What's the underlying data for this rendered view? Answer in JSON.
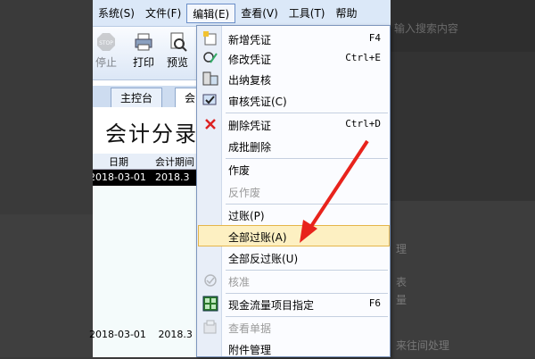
{
  "menubar": {
    "items": [
      {
        "label": "系统(S)"
      },
      {
        "label": "文件(F)"
      },
      {
        "label": "编辑(E)"
      },
      {
        "label": "查看(V)"
      },
      {
        "label": "工具(T)"
      },
      {
        "label": "帮助"
      }
    ]
  },
  "toolbar": {
    "stop_label": "停止",
    "print_label": "打印",
    "preview_label": "预览"
  },
  "tabs": {
    "console_label": "主控台",
    "active_label": "会"
  },
  "voucher": {
    "title": "会计分录",
    "columns": [
      "日期",
      "会计期间"
    ],
    "rows": [
      {
        "date": "2018-03-01",
        "period": "2018.3"
      },
      {
        "date": "2018-03-01",
        "period": "2018.3"
      }
    ]
  },
  "edit_menu": {
    "items": [
      {
        "label": "新增凭证",
        "shortcut": "F4",
        "icon": "new-voucher-icon"
      },
      {
        "label": "修改凭证",
        "shortcut": "Ctrl+E",
        "icon": "edit-voucher-icon"
      },
      {
        "label": "出纳复核",
        "shortcut": "",
        "icon": "cashier-review-icon"
      },
      {
        "label": "审核凭证(C)",
        "shortcut": "",
        "icon": "audit-voucher-icon"
      },
      {
        "label": "删除凭证",
        "shortcut": "Ctrl+D",
        "icon": "delete-icon"
      },
      {
        "label": "成批删除",
        "shortcut": ""
      },
      {
        "label": "作废",
        "shortcut": ""
      },
      {
        "label": "反作废",
        "shortcut": "",
        "disabled": true
      },
      {
        "label": "过账(P)",
        "shortcut": ""
      },
      {
        "label": "全部过账(A)",
        "shortcut": "",
        "highlighted": true
      },
      {
        "label": "全部反过账(U)",
        "shortcut": ""
      },
      {
        "label": "核准",
        "shortcut": "",
        "disabled": true,
        "icon": "approve-icon"
      },
      {
        "label": "现金流量项目指定",
        "shortcut": "F6",
        "icon": "cashflow-icon"
      },
      {
        "label": "查看单据",
        "shortcut": "",
        "disabled": true,
        "icon": "view-document-icon"
      },
      {
        "label": "附件管理",
        "shortcut": ""
      }
    ]
  },
  "background": {
    "search_placeholder": "输入搜索内容",
    "fragments": [
      "理",
      "表",
      "量",
      "来往间处理"
    ]
  },
  "colors": {
    "highlight_bg": "#fdf0c2",
    "highlight_border": "#e5b54a",
    "arrow": "#e8231c",
    "menubar_bg": "#dbe8f8"
  }
}
